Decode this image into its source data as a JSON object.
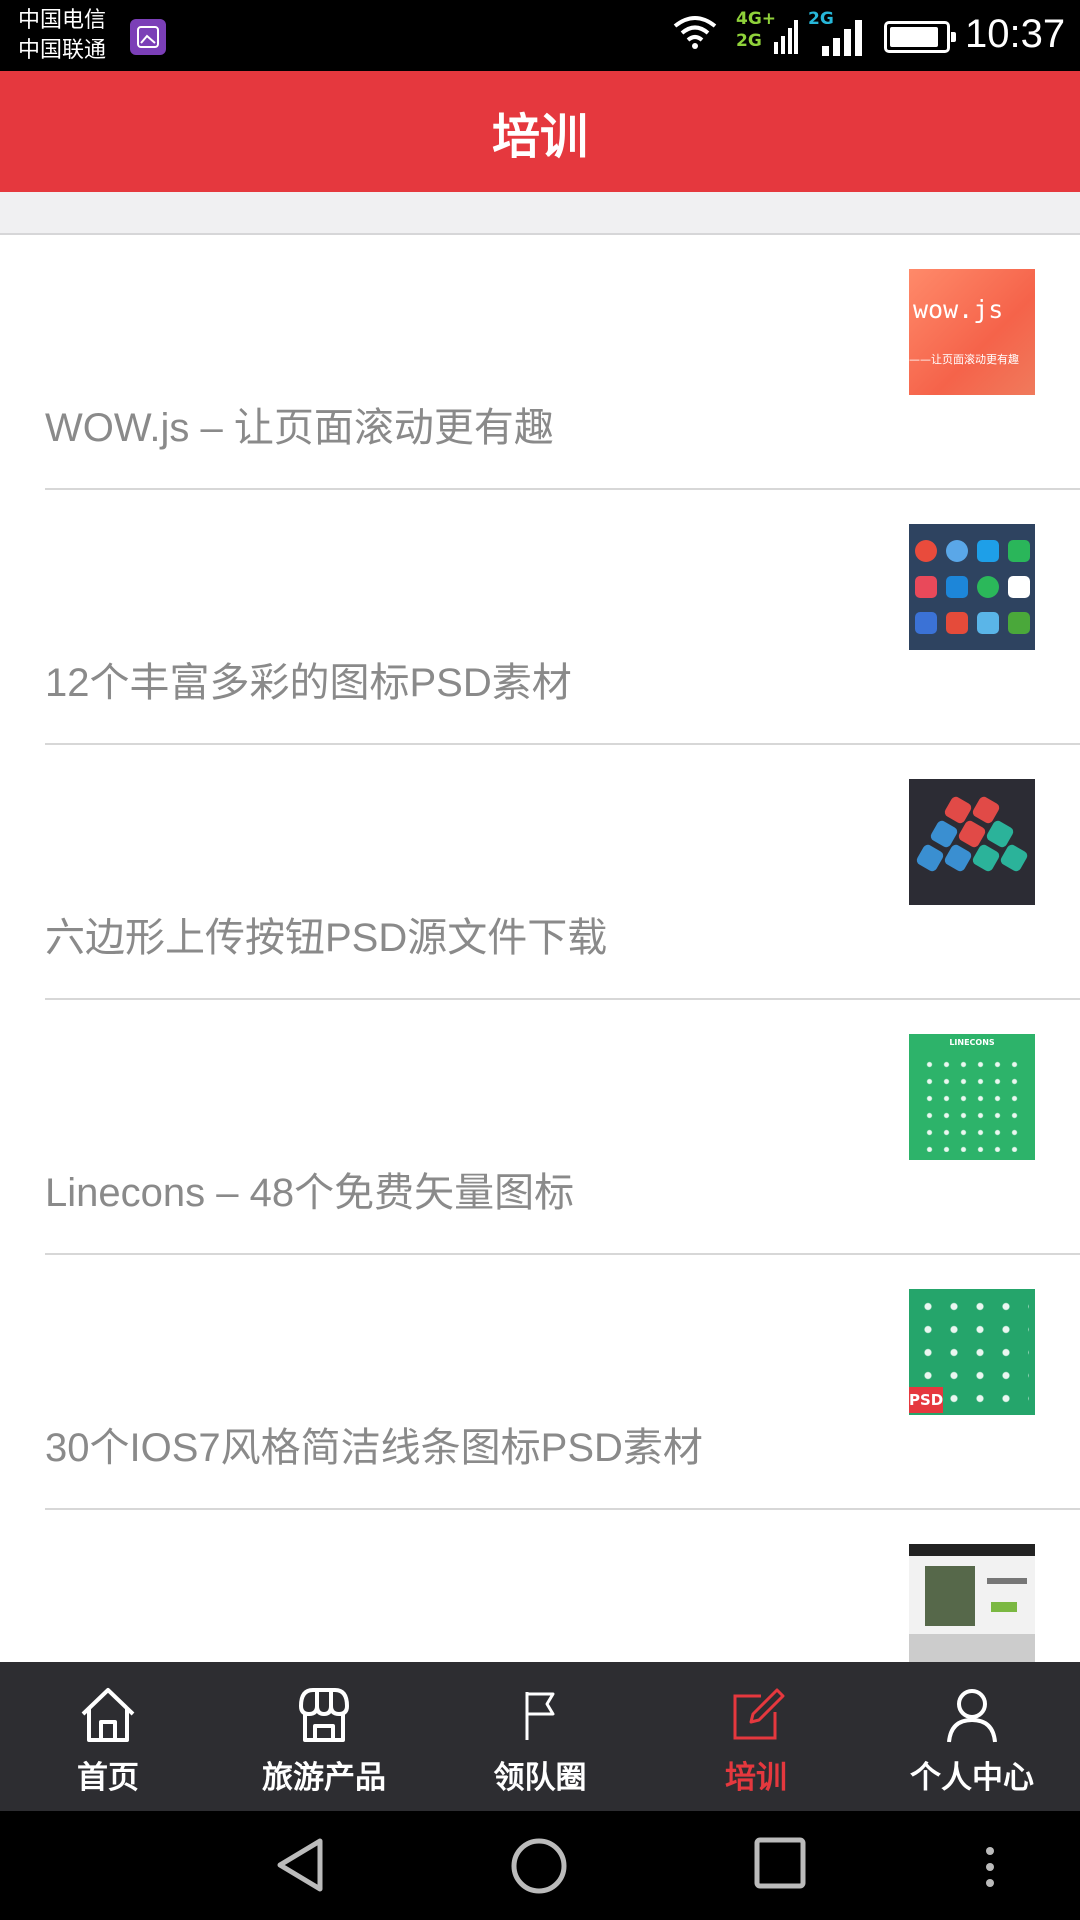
{
  "status_bar": {
    "carrier_1": "中国电信",
    "carrier_2": "中国联通",
    "network_1": "4G+",
    "network_1b": "2G",
    "network_2": "2G",
    "time": "10:37",
    "battery_level": 0.9,
    "icons": [
      "gallery-icon",
      "wifi-icon",
      "signal-icon",
      "battery-icon"
    ]
  },
  "header": {
    "title": "培训"
  },
  "articles": [
    {
      "title": "WOW.js – 让页面滚动更有趣",
      "thumb_text": "wow.js",
      "thumb_caption": "——让页面滚动更有趣"
    },
    {
      "title": "12个丰富多彩的图标PSD素材"
    },
    {
      "title": "六边形上传按钮PSD源文件下载"
    },
    {
      "title": "Linecons – 48个免费矢量图标",
      "thumb_text": "LINECONS"
    },
    {
      "title": "30个IOS7风格简洁线条图标PSD素材",
      "thumb_text": "PSD"
    },
    {
      "title": ""
    }
  ],
  "tabs": [
    {
      "label": "首页",
      "icon": "home-icon"
    },
    {
      "label": "旅游产品",
      "icon": "store-icon"
    },
    {
      "label": "领队圈",
      "icon": "flag-icon"
    },
    {
      "label": "培训",
      "icon": "edit-icon"
    },
    {
      "label": "个人中心",
      "icon": "user-icon"
    }
  ],
  "active_tab": "培训",
  "colors": {
    "accent": "#e5383e",
    "tabbar": "#2d2d31",
    "title_text": "#8a8a8a"
  }
}
